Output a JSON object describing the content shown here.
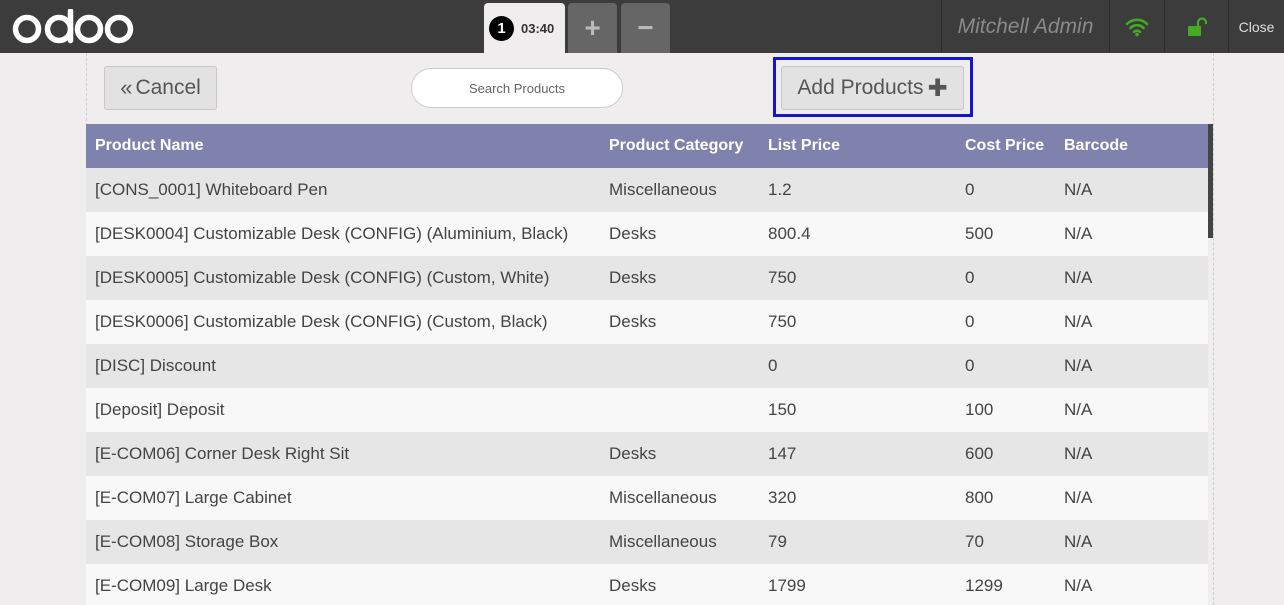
{
  "topbar": {
    "logo_text": "odoo",
    "order_number": "1",
    "order_time": "03:40",
    "add_order_label": "+",
    "remove_order_label": "−",
    "user_name": "Mitchell Admin",
    "close_label": "Close",
    "wifi_color": "#44aa22",
    "lock_color": "#44aa22"
  },
  "toolbar": {
    "cancel_label": "Cancel",
    "cancel_icon": "double-chevron-left-icon",
    "search_placeholder": "Search Products",
    "add_label": "Add Products",
    "add_icon": "plus-icon",
    "highlight_color": "#1414d4"
  },
  "table": {
    "header_color": "#7f82ac",
    "columns": [
      "Product Name",
      "Product Category",
      "List Price",
      "Cost Price",
      "Barcode"
    ],
    "rows": [
      [
        "[CONS_0001] Whiteboard Pen",
        "Miscellaneous",
        "1.2",
        "0",
        "N/A"
      ],
      [
        "[DESK0004] Customizable Desk (CONFIG) (Aluminium, Black)",
        "Desks",
        "800.4",
        "500",
        "N/A"
      ],
      [
        "[DESK0005] Customizable Desk (CONFIG) (Custom, White)",
        "Desks",
        "750",
        "0",
        "N/A"
      ],
      [
        "[DESK0006] Customizable Desk (CONFIG) (Custom, Black)",
        "Desks",
        "750",
        "0",
        "N/A"
      ],
      [
        "[DISC] Discount",
        "",
        "0",
        "0",
        "N/A"
      ],
      [
        "[Deposit] Deposit",
        "",
        "150",
        "100",
        "N/A"
      ],
      [
        "[E-COM06] Corner Desk Right Sit",
        "Desks",
        "147",
        "600",
        "N/A"
      ],
      [
        "[E-COM07] Large Cabinet",
        "Miscellaneous",
        "320",
        "800",
        "N/A"
      ],
      [
        "[E-COM08] Storage Box",
        "Miscellaneous",
        "79",
        "70",
        "N/A"
      ],
      [
        "[E-COM09] Large Desk",
        "Desks",
        "1799",
        "1299",
        "N/A"
      ]
    ]
  }
}
